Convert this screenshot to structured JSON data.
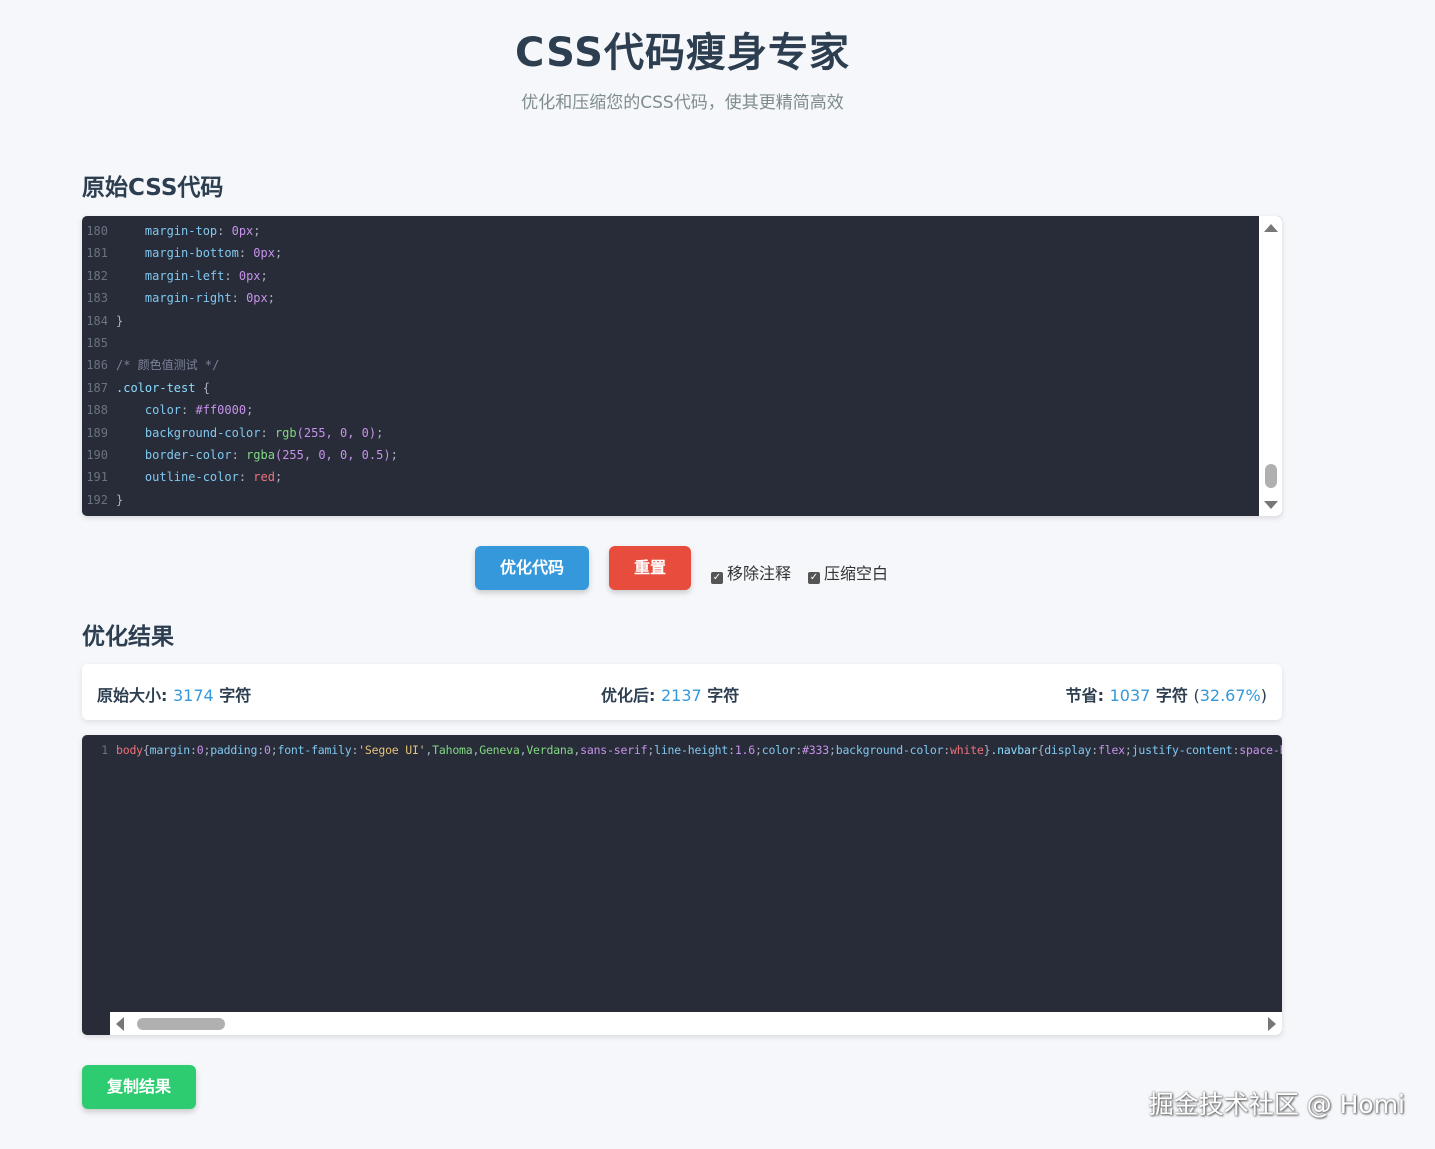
{
  "header": {
    "title": "CSS代码瘦身专家",
    "subtitle": "优化和压缩您的CSS代码，使其更精简高效"
  },
  "input_section": {
    "title": "原始CSS代码",
    "lines": [
      {
        "n": "180",
        "indent": true,
        "prop": "margin-top",
        "value": "0px"
      },
      {
        "n": "181",
        "indent": true,
        "prop": "margin-bottom",
        "value": "0px"
      },
      {
        "n": "182",
        "indent": true,
        "prop": "margin-left",
        "value": "0px"
      },
      {
        "n": "183",
        "indent": true,
        "prop": "margin-right",
        "value": "0px"
      },
      {
        "n": "184",
        "text": "}"
      },
      {
        "n": "185",
        "text": ""
      },
      {
        "n": "186",
        "comment": "/* 颜色值测试 */"
      },
      {
        "n": "187",
        "selector": ".color-test",
        "text": " {"
      },
      {
        "n": "188",
        "indent": true,
        "prop": "color",
        "value": "#ff0000"
      },
      {
        "n": "189",
        "indent": true,
        "prop": "background-color",
        "fn": "rgb",
        "args": "(255, 0, 0)"
      },
      {
        "n": "190",
        "indent": true,
        "prop": "border-color",
        "fn": "rgba",
        "args": "(255, 0, 0, 0.5)"
      },
      {
        "n": "191",
        "indent": true,
        "prop": "outline-color",
        "kw": "red"
      },
      {
        "n": "192",
        "text": "}"
      }
    ]
  },
  "actions": {
    "optimize_label": "优化代码",
    "reset_label": "重置",
    "remove_comments_label": "移除注释",
    "remove_comments_checked": true,
    "compress_whitespace_label": "压缩空白",
    "compress_whitespace_checked": true
  },
  "result_section": {
    "title": "优化结果",
    "original_label": "原始大小:",
    "original_value": "3174",
    "optimized_label": "优化后:",
    "optimized_value": "2137",
    "saved_label": "节省:",
    "saved_value": "1037",
    "saved_percent": "32.67%",
    "unit": "字符",
    "output_line_number": "1"
  },
  "copy_label": "复制结果",
  "watermark": "掘金技术社区 @ Homi",
  "colors": {
    "primary": "#3498db",
    "danger": "#e74c3c",
    "success": "#2ecc71",
    "editor_bg": "#282c38"
  }
}
